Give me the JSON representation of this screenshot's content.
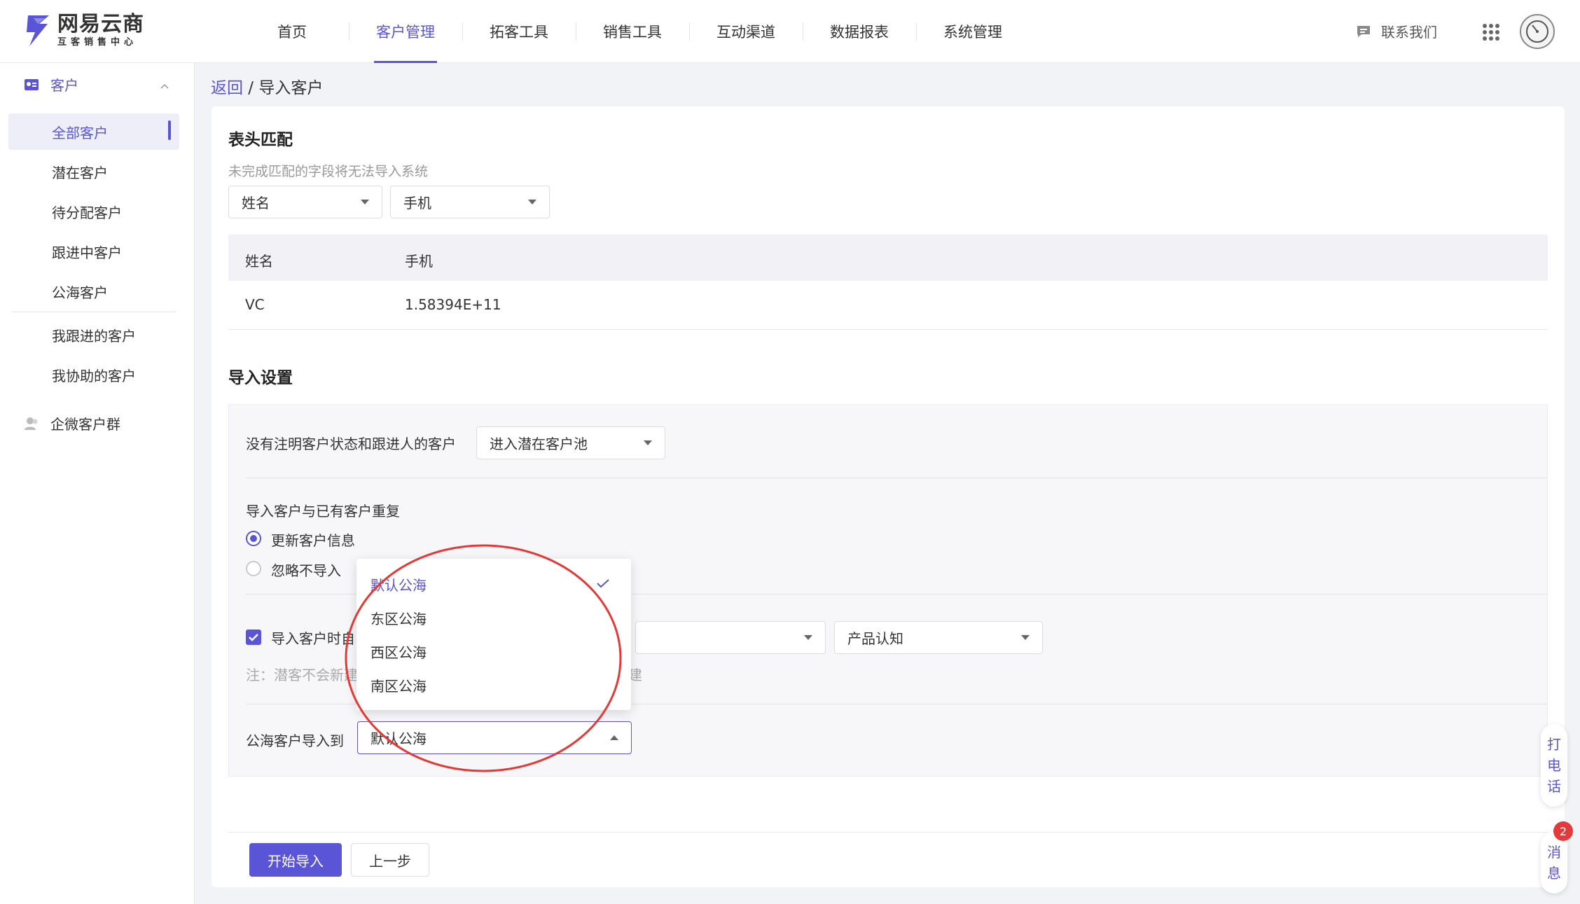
{
  "brand": {
    "title": "网易云商",
    "subtitle": "互客销售中心",
    "color": "#5a55d6"
  },
  "nav": {
    "items": [
      {
        "label": "首页"
      },
      {
        "label": "客户管理",
        "active": true
      },
      {
        "label": "拓客工具"
      },
      {
        "label": "销售工具"
      },
      {
        "label": "互动渠道"
      },
      {
        "label": "数据报表"
      },
      {
        "label": "系统管理"
      }
    ],
    "contact": "联系我们",
    "apps_icon": "grid-icon",
    "avatar_icon": "avatar"
  },
  "sidebar": {
    "group": "客户",
    "items": [
      {
        "label": "全部客户",
        "active": true
      },
      {
        "label": "潜在客户"
      },
      {
        "label": "待分配客户"
      },
      {
        "label": "跟进中客户"
      },
      {
        "label": "公海客户"
      },
      {
        "label": "我跟进的客户"
      },
      {
        "label": "我协助的客户"
      }
    ],
    "wecom": "企微客户群"
  },
  "breadcrumb": {
    "back": "返回",
    "separator": " / ",
    "current": "导入客户"
  },
  "header_match": {
    "title": "表头匹配",
    "hint": "未完成匹配的字段将无法导入系统",
    "selects": [
      "姓名",
      "手机"
    ],
    "columns": [
      "姓名",
      "手机"
    ],
    "rows": [
      [
        "VC",
        "1.58394E+11"
      ]
    ]
  },
  "import_settings": {
    "title": "导入设置",
    "no_status_label": "没有注明客户状态和跟进人的客户",
    "no_status_value": "进入潜在客户池",
    "duplicate_label": "导入客户与已有客户重复",
    "options": [
      {
        "label": "更新客户信息",
        "checked": true
      },
      {
        "label": "忽略不导入",
        "checked": false
      }
    ],
    "auto_label": "导入客户时自",
    "stage_value": "产品认知",
    "note_prefix": "注：潜客不会新建",
    "note_suffix": "建",
    "pool_label": "公海客户导入到",
    "pool_value": "默认公海"
  },
  "dropdown": {
    "options": [
      {
        "label": "默认公海",
        "selected": true
      },
      {
        "label": "东区公海"
      },
      {
        "label": "西区公海"
      },
      {
        "label": "南区公海"
      }
    ]
  },
  "buttons": {
    "start": "开始导入",
    "prev": "上一步"
  },
  "float": {
    "call": [
      "打",
      "电",
      "话"
    ],
    "message": [
      "消",
      "息"
    ],
    "badge": "2"
  },
  "annotation_color": "#e53935"
}
